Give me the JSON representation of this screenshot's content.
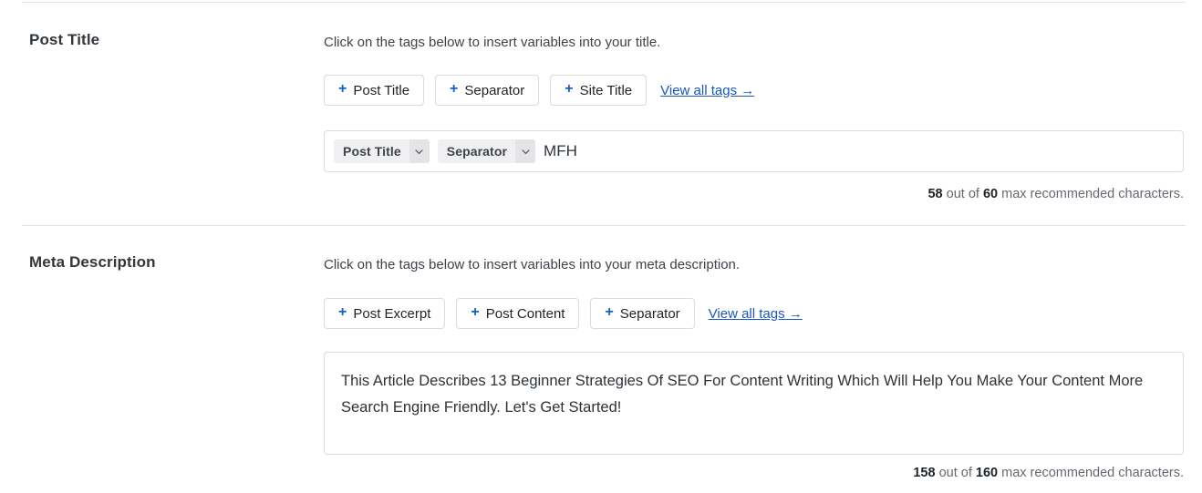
{
  "sections": [
    {
      "id": "post-title",
      "label": "Post Title",
      "helper": "Click on the tags below to insert variables into your title.",
      "tag_buttons": [
        {
          "plus": "+",
          "label": "Post Title"
        },
        {
          "plus": "+",
          "label": "Separator"
        },
        {
          "plus": "+",
          "label": "Site Title"
        }
      ],
      "view_all_label": "View all tags →",
      "field": {
        "chips": [
          {
            "label": "Post Title",
            "caret": "chevron-down-icon"
          },
          {
            "label": "Separator",
            "caret": "chevron-down-icon"
          }
        ],
        "trailing_text": "MFH"
      },
      "counter": {
        "count": "58",
        "mid": "out of",
        "max": "60",
        "suffix": "max recommended characters."
      }
    },
    {
      "id": "meta-description",
      "label": "Meta Description",
      "helper": "Click on the tags below to insert variables into your meta description.",
      "tag_buttons": [
        {
          "plus": "+",
          "label": "Post Excerpt"
        },
        {
          "plus": "+",
          "label": "Post Content"
        },
        {
          "plus": "+",
          "label": "Separator"
        }
      ],
      "view_all_label": "View all tags →",
      "field": {
        "value": "This Article Describes 13 Beginner Strategies Of SEO For Content Writing Which Will Help You Make Your Content More Search Engine Friendly. Let's Get Started!"
      },
      "counter": {
        "count": "158",
        "mid": "out of",
        "max": "160",
        "suffix": "max recommended characters."
      }
    }
  ],
  "colors": {
    "link": "#1a56c4",
    "plus": "#135fd0",
    "border": "#dcdcde",
    "chip_bg": "#f0f0f2",
    "chip_caret_bg": "#e4e4e7",
    "text": "#1d2327",
    "muted": "#646970"
  }
}
